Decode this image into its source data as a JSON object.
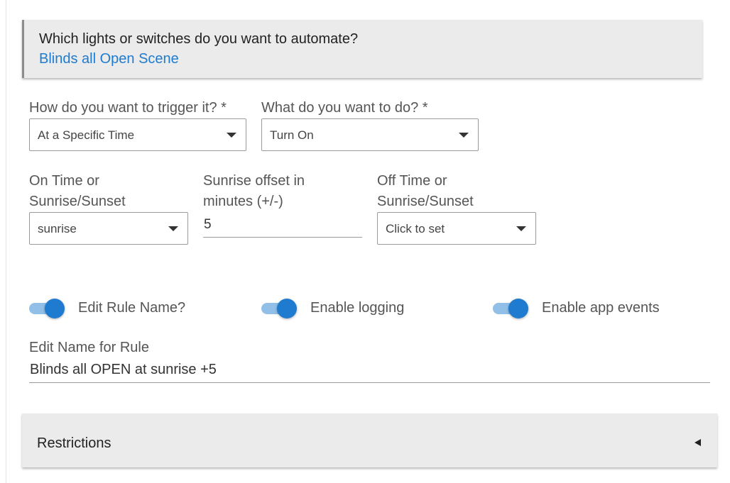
{
  "device_section": {
    "question": "Which lights or switches do you want to automate?",
    "selected_device": "Blinds all Open Scene"
  },
  "trigger": {
    "label": "How do you want to trigger it? *",
    "value": "At a Specific Time"
  },
  "action": {
    "label": "What do you want to do? *",
    "value": "Turn On"
  },
  "on_time": {
    "label_line1": "On Time or",
    "label_line2": "Sunrise/Sunset",
    "value": "sunrise"
  },
  "sunrise_offset": {
    "label_line1": "Sunrise offset in",
    "label_line2": "minutes (+/-)",
    "value": "5"
  },
  "off_time": {
    "label_line1": "Off Time or",
    "label_line2": "Sunrise/Sunset",
    "value": "Click to set"
  },
  "toggles": [
    {
      "label": "Edit Rule Name?",
      "state": "on"
    },
    {
      "label": "Enable logging",
      "state": "on"
    },
    {
      "label": "Enable app events",
      "state": "on"
    }
  ],
  "rule_name": {
    "label": "Edit Name for Rule",
    "value": "Blinds all OPEN at sunrise +5"
  },
  "restrictions": {
    "title": "Restrictions"
  },
  "colors": {
    "accent": "#1e7bcf",
    "toggle_track": "#92bfe8",
    "card_background": "#ebebeb"
  },
  "icons": {
    "dropdown": "caret-down-icon",
    "collapse": "caret-left-icon"
  }
}
